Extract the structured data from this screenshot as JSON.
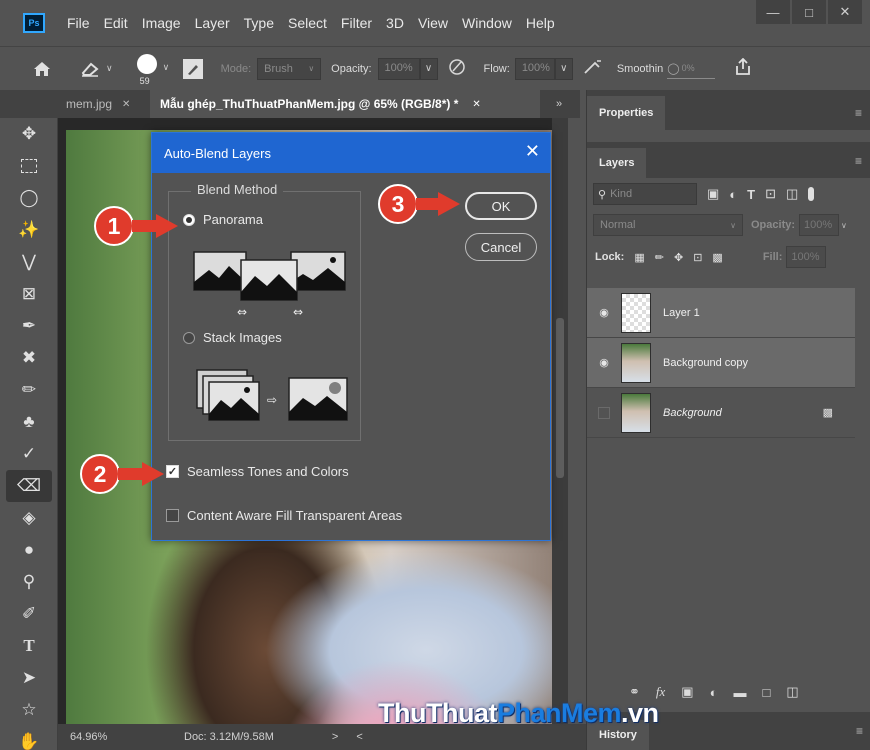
{
  "app": {
    "logo": "Ps",
    "menu": [
      "File",
      "Edit",
      "Image",
      "Layer",
      "Type",
      "Select",
      "Filter",
      "3D",
      "View",
      "Window",
      "Help"
    ]
  },
  "options_bar": {
    "brush_size": "59",
    "mode_label": "Mode:",
    "mode_value": "Brush",
    "opacity_label": "Opacity:",
    "opacity_value": "100%",
    "flow_label": "Flow:",
    "flow_value": "100%",
    "smoothing_label": "Smoothin",
    "smoothing_value": "0%"
  },
  "tabs": {
    "inactive": "mem.jpg",
    "active": "Mẫu ghép_ThuThuatPhanMem.jpg @ 65% (RGB/8*) *"
  },
  "status": {
    "zoom": "64.96%",
    "doc": "Doc: 3.12M/9.58M"
  },
  "properties_panel": {
    "title": "Properties"
  },
  "layers_panel": {
    "title": "Layers",
    "filter_placeholder": "Kind",
    "blend_mode": "Normal",
    "opacity_label": "Opacity:",
    "opacity_value": "100%",
    "lock_label": "Lock:",
    "fill_label": "Fill:",
    "fill_value": "100%",
    "layers": [
      {
        "name": "Layer 1",
        "visible": true,
        "selected": true,
        "locked": false
      },
      {
        "name": "Background copy",
        "visible": true,
        "selected": true,
        "locked": false
      },
      {
        "name": "Background",
        "visible": false,
        "selected": false,
        "locked": true
      }
    ]
  },
  "history_panel": {
    "title": "History"
  },
  "dialog": {
    "title": "Auto-Blend Layers",
    "group_label": "Blend Method",
    "panorama_label": "Panorama",
    "stack_label": "Stack Images",
    "method_selected": "Panorama",
    "seamless_label": "Seamless Tones and Colors",
    "seamless_checked": true,
    "content_aware_label": "Content Aware Fill Transparent Areas",
    "content_aware_checked": false,
    "ok_label": "OK",
    "cancel_label": "Cancel"
  },
  "callouts": [
    "1",
    "2",
    "3"
  ],
  "watermark": {
    "part1": "ThuThuat",
    "part2": "PhanMem",
    "part3": ".vn",
    "color1": "#ffffff",
    "color2": "#1a7de0",
    "color3": "#ffffff"
  },
  "colors": {
    "accent": "#1f66d1",
    "callout": "#e03b2c",
    "panel_bg": "#535353"
  }
}
